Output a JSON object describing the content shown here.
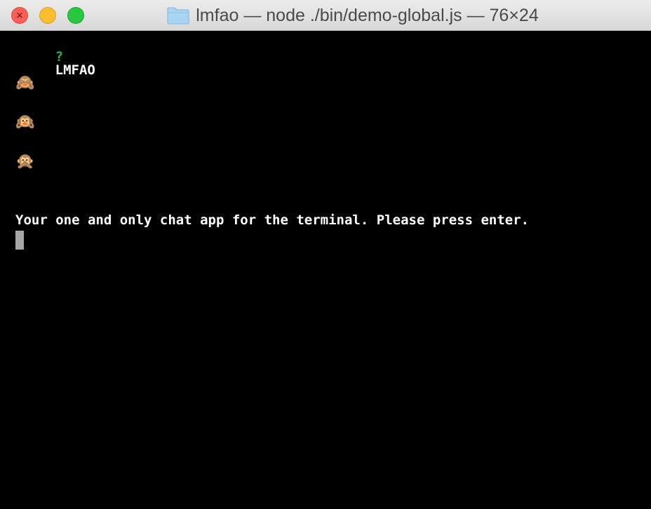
{
  "window": {
    "title": "lmfao — node ./bin/demo-global.js — 76×24",
    "folder_icon": "folder-icon"
  },
  "terminal": {
    "prompt_symbol": "?",
    "prompt_text": "LMFAO",
    "emojis": [
      {
        "icon": "see-no-evil-monkey-icon",
        "char": "🙈"
      },
      {
        "icon": "hear-no-evil-monkey-icon",
        "char": "🙉"
      },
      {
        "icon": "speak-no-evil-monkey-icon",
        "char": "🙊"
      }
    ],
    "message": "Your one and only chat app for the terminal. Please press enter.",
    "colors": {
      "background": "#000000",
      "prompt_symbol": "#2fb535",
      "text": "#ffffff",
      "cursor": "#a6a6a6"
    }
  }
}
